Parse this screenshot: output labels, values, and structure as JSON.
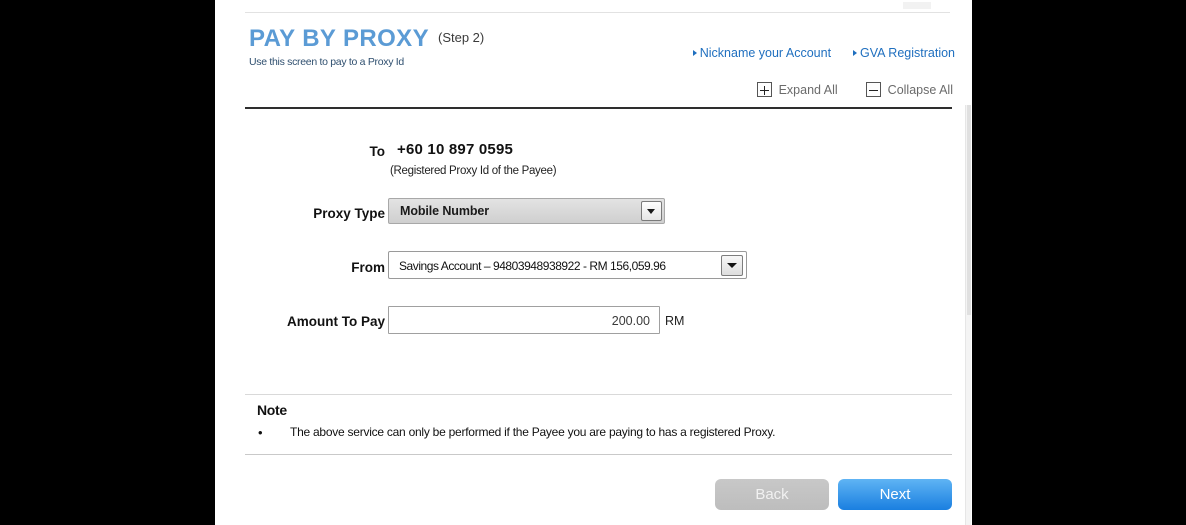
{
  "header": {
    "title": "PAY BY PROXY",
    "step": "(Step 2)",
    "subtitle": "Use this screen to pay to a Proxy Id",
    "links": [
      {
        "label": "Nickname your Account",
        "icon": "arrow-bullet-icon"
      },
      {
        "label": "GVA Registration",
        "icon": "arrow-bullet-icon"
      }
    ],
    "expand_all": {
      "label": "Expand All",
      "icon": "plus-box-icon"
    },
    "collapse_all": {
      "label": "Collapse All",
      "icon": "minus-box-icon"
    }
  },
  "form": {
    "to": {
      "label": "To",
      "value": "+60 10 897 0595",
      "hint": "(Registered Proxy Id of the Payee)"
    },
    "proxy_type": {
      "label": "Proxy Type",
      "value": "Mobile Number",
      "icon": "chevron-down-icon"
    },
    "from": {
      "label": "From",
      "value": "Savings Account – 94803948938922 -  RM 156,059.96",
      "icon": "chevron-down-icon"
    },
    "amount": {
      "label": "Amount To Pay",
      "value": "200.00",
      "unit": "RM"
    }
  },
  "note": {
    "heading": "Note",
    "bullet": "•",
    "text": "The above service can only be performed if the Payee you are paying to has a registered Proxy."
  },
  "buttons": {
    "back": "Back",
    "next": "Next"
  },
  "colors": {
    "title_blue": "#5b9bd5",
    "link_blue": "#1f6fbf",
    "next_button_blue": "#1a7fe0",
    "back_button_grey": "#c2c2c2",
    "divider_dark": "#2e2e2e"
  }
}
